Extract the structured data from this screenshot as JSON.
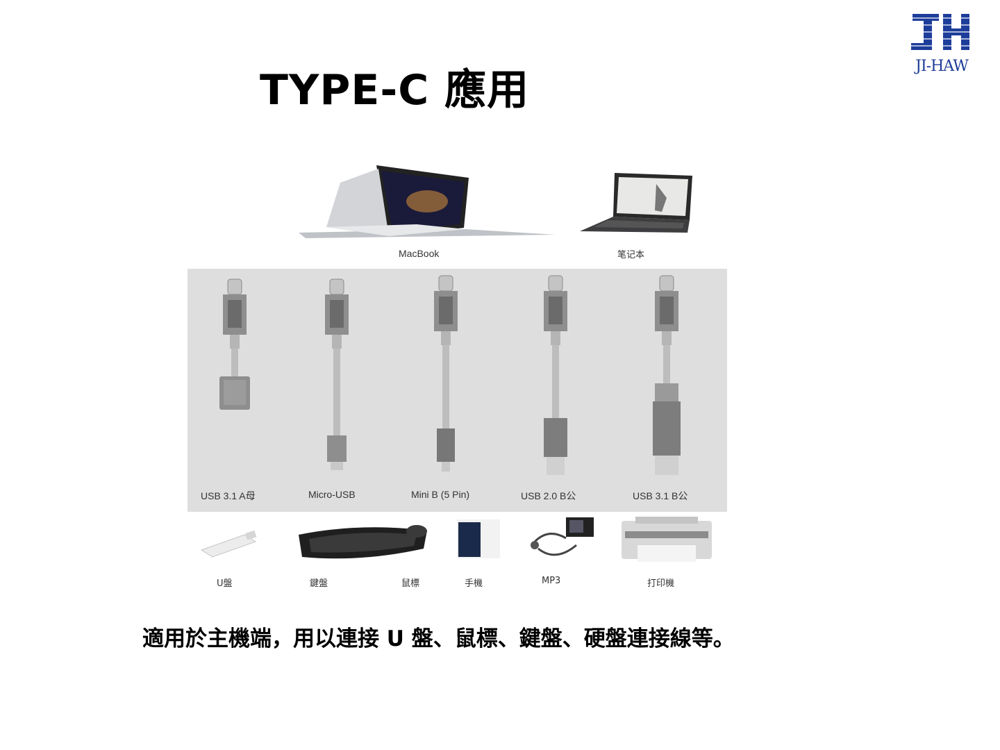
{
  "logo": {
    "text": "JI-HAW"
  },
  "title": "TYPE-C 應用",
  "figure": {
    "top_devices": [
      "MacBook",
      "笔记本"
    ],
    "connectors": [
      "USB 3.1 A母",
      "Micro-USB",
      "Mini B (5 Pin)",
      "USB 2.0 B公",
      "USB 3.1 B公"
    ],
    "bottom_devices": [
      "U盤",
      "鍵盤",
      "鼠標",
      "手機",
      "MP3",
      "打印機"
    ]
  },
  "caption": "適用於主機端，用以連接 U 盤、鼠標、鍵盤、硬盤連接線等。",
  "colors": {
    "logo_blue": "#1d3d9a",
    "panel_gray": "#dedede",
    "text": "#000000"
  }
}
